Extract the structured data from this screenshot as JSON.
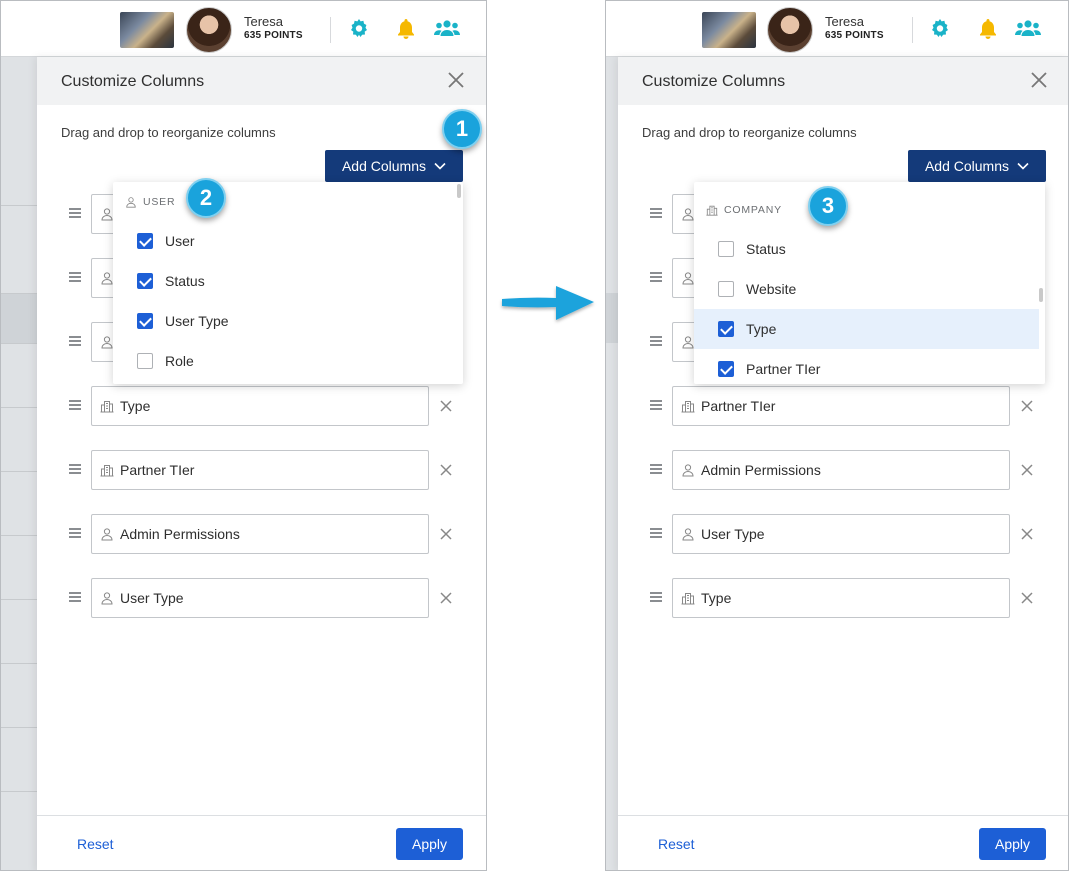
{
  "user": {
    "name": "Teresa",
    "points": "635 POINTS"
  },
  "colors": {
    "teal": "#1ab3c8",
    "bell": "#f5b800",
    "navy": "#143a7a",
    "blue": "#1d5fd6",
    "badge": "#1aa3dc"
  },
  "modal": {
    "title": "Customize Columns",
    "hint": "Drag and drop to reorganize columns",
    "add_label": "Add Columns",
    "reset_label": "Reset",
    "apply_label": "Apply"
  },
  "left": {
    "dropdown": {
      "header": "USER",
      "items": [
        {
          "label": "User",
          "checked": true
        },
        {
          "label": "Status",
          "checked": true
        },
        {
          "label": "User Type",
          "checked": true
        },
        {
          "label": "Role",
          "checked": false
        }
      ]
    },
    "rows": [
      {
        "label": "Type",
        "icon": "company-icon"
      },
      {
        "label": "Partner TIer",
        "icon": "company-icon"
      },
      {
        "label": "Admin Permissions",
        "icon": "user-icon"
      },
      {
        "label": "User Type",
        "icon": "user-icon"
      }
    ]
  },
  "right": {
    "dropdown": {
      "header": "COMPANY",
      "items": [
        {
          "label": "Status",
          "checked": false
        },
        {
          "label": "Website",
          "checked": false
        },
        {
          "label": "Type",
          "checked": true
        },
        {
          "label": "Partner TIer",
          "checked": true
        }
      ]
    },
    "rows": [
      {
        "label": "Partner TIer",
        "icon": "company-icon"
      },
      {
        "label": "Admin Permissions",
        "icon": "user-icon"
      },
      {
        "label": "User Type",
        "icon": "user-icon"
      },
      {
        "label": "Type",
        "icon": "company-icon"
      }
    ]
  },
  "badges": [
    "1",
    "2",
    "3"
  ]
}
